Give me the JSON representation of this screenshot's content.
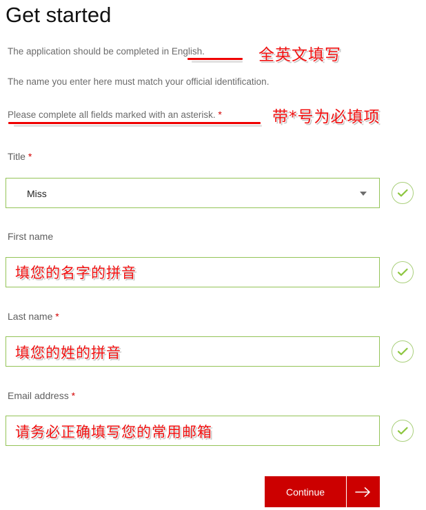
{
  "page": {
    "title": "Get started"
  },
  "intro": {
    "line1": "The application should be completed in English.",
    "line2": "The name you enter here must match your official identification.",
    "line3": "Please complete all fields marked with an asterisk.",
    "line3_asterisk": "*"
  },
  "annotations": {
    "note_english": "全英文填写",
    "note_required": "带*号为必填项",
    "note_first_name": "填您的名字的拼音",
    "note_last_name": "填您的姓的拼音",
    "note_email": "请务必正确填写您的常用邮箱"
  },
  "form": {
    "fields": [
      {
        "label": "Title",
        "required_mark": "*",
        "type": "select",
        "value": "Miss",
        "valid": true
      },
      {
        "label": "First name",
        "required_mark": "",
        "type": "text",
        "value": "",
        "valid": true
      },
      {
        "label": "Last name",
        "required_mark": "*",
        "type": "text",
        "value": "",
        "valid": true
      },
      {
        "label": "Email address",
        "required_mark": "*",
        "type": "email",
        "value": "",
        "valid": true
      }
    ]
  },
  "actions": {
    "continue_label": "Continue",
    "continue_arrow": "→"
  },
  "colors": {
    "brand_red": "#cc0000",
    "annotation_red": "#f01010",
    "field_border_green": "#93c356",
    "tick_green": "#8dc63f",
    "body_text_gray": "#6b6b6b"
  }
}
